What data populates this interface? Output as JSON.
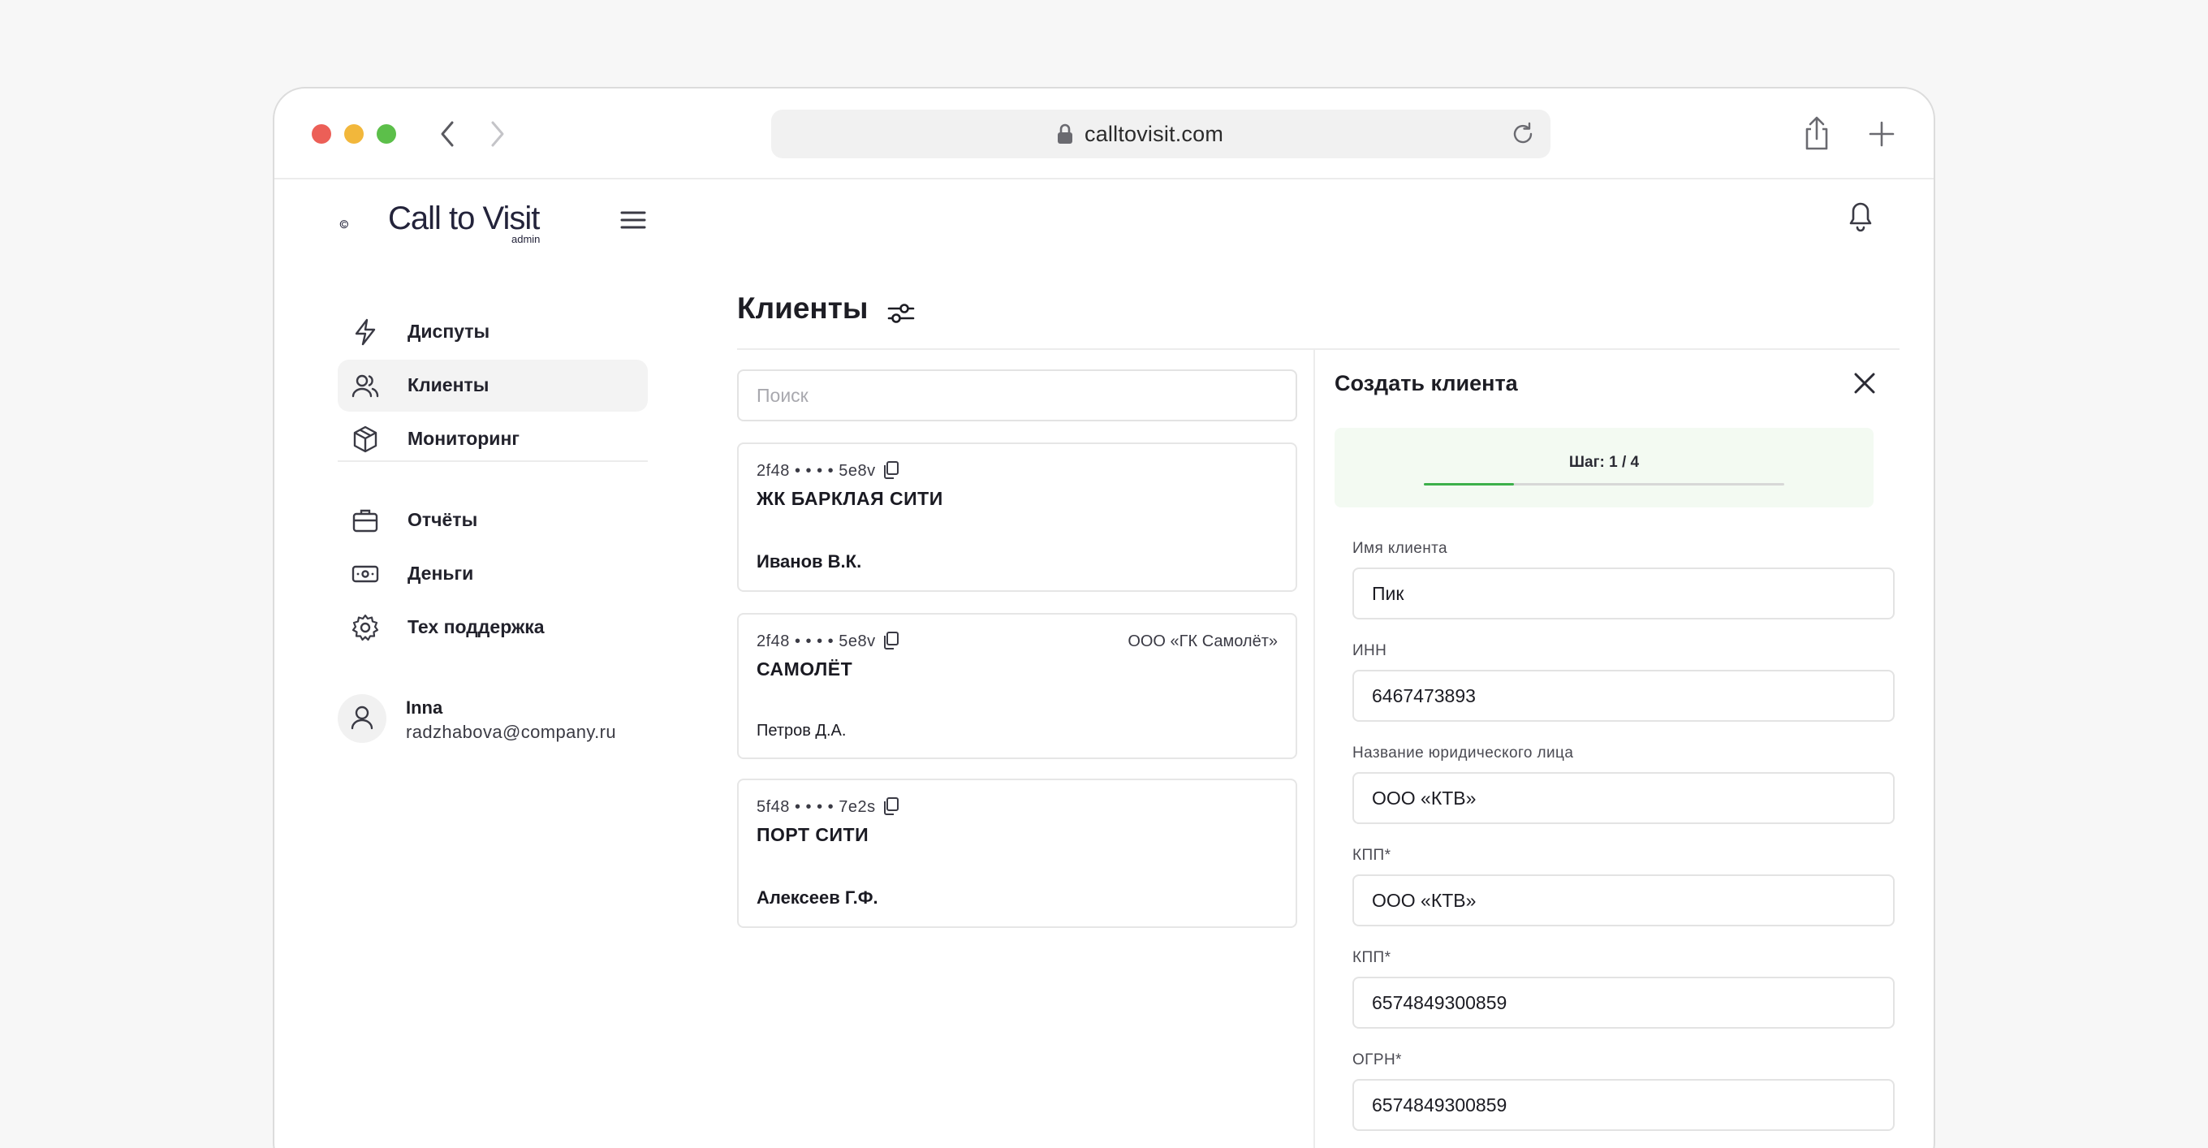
{
  "browser": {
    "url": "calltovisit.com"
  },
  "brand": {
    "name": "Call to Visit",
    "subtitle": "admin"
  },
  "sidebar": {
    "items": [
      {
        "label": "Диспуты",
        "icon": "lightning-icon"
      },
      {
        "label": "Клиенты",
        "icon": "users-icon",
        "active": true
      },
      {
        "label": "Мониторинг",
        "icon": "box-icon"
      },
      {
        "label": "Отчёты",
        "icon": "briefcase-icon"
      },
      {
        "label": "Деньги",
        "icon": "banknote-icon"
      },
      {
        "label": "Тех поддержка",
        "icon": "gear-icon"
      }
    ],
    "user": {
      "name": "Inna",
      "email": "radzhabova@company.ru"
    }
  },
  "main": {
    "title": "Клиенты",
    "search_placeholder": "Поиск",
    "clients": [
      {
        "id": "2f48 • • • • 5e8v",
        "name": "ЖК БАРКЛАЯ СИТИ",
        "org": "",
        "person": "Иванов В.К."
      },
      {
        "id": "2f48 • • • • 5e8v",
        "name": "САМОЛЁТ",
        "org": "ООО «ГК Самолёт»",
        "person": "Петров Д.А."
      },
      {
        "id": "5f48 • • • • 7e2s",
        "name": "ПОРТ СИТИ",
        "org": "",
        "person": "Алексеев Г.Ф."
      }
    ]
  },
  "form": {
    "title": "Создать клиента",
    "step_label": "Шаг: 1 / 4",
    "step_current": 1,
    "step_total": 4,
    "fields": [
      {
        "label": "Имя клиента",
        "value": "Пик"
      },
      {
        "label": "ИНН",
        "value": "6467473893"
      },
      {
        "label": "Название юридического лица",
        "value": "ООО «КТВ»"
      },
      {
        "label": "КПП*",
        "value": "ООО «КТВ»"
      },
      {
        "label": "КПП*",
        "value": "6574849300859"
      },
      {
        "label": "ОГРН*",
        "value": "6574849300859"
      }
    ]
  },
  "colors": {
    "accent_green": "#3cb04a",
    "stepper_bg": "#f3faf2",
    "active_nav_bg": "#f3f3f3"
  }
}
